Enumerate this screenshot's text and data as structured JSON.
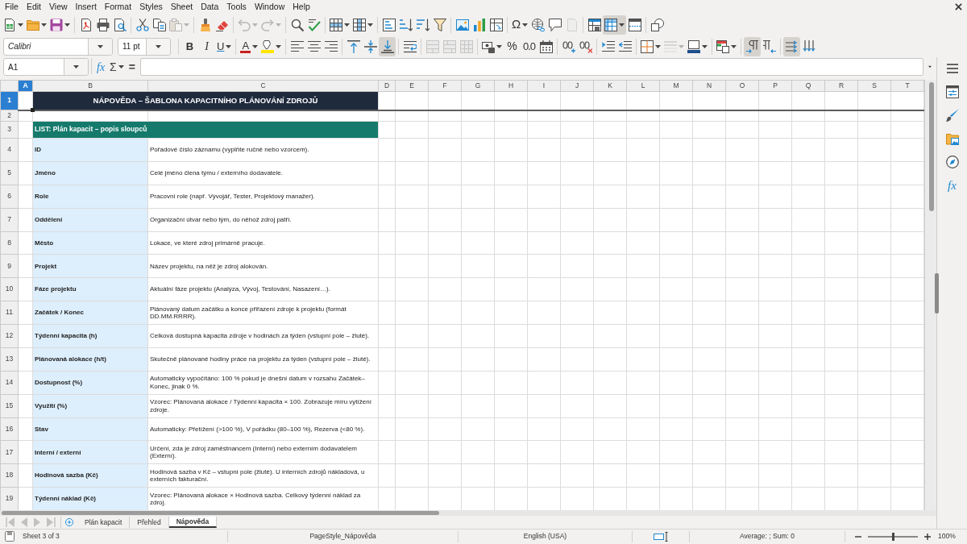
{
  "menu": [
    "File",
    "Edit",
    "View",
    "Insert",
    "Format",
    "Styles",
    "Sheet",
    "Data",
    "Tools",
    "Window",
    "Help"
  ],
  "standard_toolbar": [
    {
      "pressed": false,
      "disabled": false
    },
    {
      "pressed": false,
      "disabled": false
    },
    {
      "pressed": false,
      "disabled": false
    },
    {
      "pressed": false,
      "disabled": false
    },
    {
      "pressed": false,
      "disabled": false
    },
    {
      "pressed": false,
      "disabled": false
    },
    {
      "pressed": false,
      "disabled": false
    },
    {
      "pressed": false,
      "disabled": false
    },
    {
      "pressed": false,
      "disabled": true
    },
    {
      "pressed": false,
      "disabled": false
    },
    {
      "pressed": false,
      "disabled": false
    },
    {
      "pressed": false,
      "disabled": true
    },
    {
      "pressed": false,
      "disabled": true
    },
    {
      "pressed": false,
      "disabled": false
    },
    {
      "pressed": false,
      "disabled": false
    },
    {
      "pressed": false,
      "disabled": false
    },
    {
      "pressed": false,
      "disabled": false
    },
    {
      "pressed": false,
      "disabled": false
    },
    {
      "pressed": false,
      "disabled": false
    },
    {
      "pressed": false,
      "disabled": false
    },
    {
      "pressed": false,
      "disabled": false
    },
    {
      "pressed": false,
      "disabled": false
    },
    {
      "pressed": false,
      "disabled": false
    },
    {
      "pressed": false,
      "disabled": false
    },
    {
      "pressed": false,
      "disabled": false,
      "label": "Ω"
    },
    {
      "pressed": false,
      "disabled": false
    },
    {
      "pressed": false,
      "disabled": false
    },
    {
      "pressed": false,
      "disabled": true
    },
    {
      "pressed": false,
      "disabled": false
    },
    {
      "pressed": true,
      "disabled": false
    },
    {
      "pressed": false,
      "disabled": false
    },
    {
      "pressed": false,
      "disabled": false
    }
  ],
  "formatting_toolbar": {
    "font_name": "Calibri",
    "font_size": "11 pt",
    "buttons": [
      {
        "pressed": false,
        "disabled": false,
        "label": "B"
      },
      {
        "pressed": false,
        "disabled": false,
        "label": "I"
      },
      {
        "pressed": false,
        "disabled": false,
        "label": "U"
      },
      {
        "pressed": false,
        "disabled": false,
        "label": "A"
      },
      {
        "pressed": false,
        "disabled": false
      },
      {
        "pressed": false,
        "disabled": false
      },
      {
        "pressed": false,
        "disabled": false
      },
      {
        "pressed": false,
        "disabled": false
      },
      {
        "pressed": false,
        "disabled": false
      },
      {
        "pressed": false,
        "disabled": false
      },
      {
        "pressed": true,
        "disabled": false
      },
      {
        "pressed": false,
        "disabled": false
      },
      {
        "pressed": false,
        "disabled": true
      },
      {
        "pressed": false,
        "disabled": true
      },
      {
        "pressed": false,
        "disabled": true
      },
      {
        "pressed": false,
        "disabled": false
      },
      {
        "pressed": false,
        "disabled": false,
        "label": "%"
      },
      {
        "pressed": false,
        "disabled": false,
        "label": "0.0"
      },
      {
        "pressed": false,
        "disabled": false
      },
      {
        "pressed": false,
        "disabled": false
      },
      {
        "pressed": false,
        "disabled": false
      },
      {
        "pressed": false,
        "disabled": false
      },
      {
        "pressed": false,
        "disabled": false
      },
      {
        "pressed": false,
        "disabled": false
      },
      {
        "pressed": false,
        "disabled": true
      },
      {
        "pressed": false,
        "disabled": false
      },
      {
        "pressed": false,
        "disabled": false
      },
      {
        "pressed": true,
        "disabled": false
      },
      {
        "pressed": false,
        "disabled": false
      },
      {
        "pressed": true,
        "disabled": false
      },
      {
        "pressed": false,
        "disabled": false
      }
    ]
  },
  "formula_bar": {
    "cell_reference": "A1",
    "function_wizard": "fx",
    "sum": "Σ",
    "equals": "="
  },
  "sidebar": {
    "functions_label": "fx"
  },
  "sheet": {
    "columns": [
      {
        "label": "A",
        "selected": true
      },
      {
        "label": "B",
        "selected": false
      },
      {
        "label": "C",
        "selected": false
      },
      {
        "label": "D",
        "selected": false
      },
      {
        "label": "E",
        "selected": false
      },
      {
        "label": "F",
        "selected": false
      },
      {
        "label": "G",
        "selected": false
      },
      {
        "label": "H",
        "selected": false
      },
      {
        "label": "I",
        "selected": false
      },
      {
        "label": "J",
        "selected": false
      },
      {
        "label": "K",
        "selected": false
      },
      {
        "label": "L",
        "selected": false
      },
      {
        "label": "M",
        "selected": false
      },
      {
        "label": "N",
        "selected": false
      },
      {
        "label": "O",
        "selected": false
      },
      {
        "label": "P",
        "selected": false
      },
      {
        "label": "Q",
        "selected": false
      },
      {
        "label": "R",
        "selected": false
      },
      {
        "label": "S",
        "selected": false
      },
      {
        "label": "T",
        "selected": false
      }
    ],
    "rows": [
      {
        "number": "1",
        "selected": true,
        "kind": "title",
        "text": "NÁPOVĚDA – ŠABLONA KAPACITNÍHO PLÁNOVÁNÍ ZDROJŮ"
      },
      {
        "number": "2",
        "selected": false,
        "kind": "blank"
      },
      {
        "number": "3",
        "selected": false,
        "kind": "section",
        "text": "LIST: Plán kapacit – popis sloupců"
      },
      {
        "number": "4",
        "selected": false,
        "kind": "field",
        "name": "ID",
        "description": "Pořadové číslo záznamu (vyplňte ručně nebo vzorcem)."
      },
      {
        "number": "5",
        "selected": false,
        "kind": "field",
        "name": "Jméno",
        "description": "Celé jméno člena týmu / externího dodavatele."
      },
      {
        "number": "6",
        "selected": false,
        "kind": "field",
        "name": "Role",
        "description": "Pracovní role (např. Vývojář, Tester, Projektový manažer)."
      },
      {
        "number": "7",
        "selected": false,
        "kind": "field",
        "name": "Oddělení",
        "description": "Organizační útvar nebo tým, do něhož zdroj patří."
      },
      {
        "number": "8",
        "selected": false,
        "kind": "field",
        "name": "Město",
        "description": "Lokace, ve které zdroj primárně pracuje."
      },
      {
        "number": "9",
        "selected": false,
        "kind": "field",
        "name": "Projekt",
        "description": "Název projektu, na něž je zdroj alokován."
      },
      {
        "number": "10",
        "selected": false,
        "kind": "field",
        "name": "Fáze projektu",
        "description": "Aktuální fáze projektu (Analýza, Vývoj, Testování, Nasazení…)."
      },
      {
        "number": "11",
        "selected": false,
        "kind": "field",
        "name": "Začátek / Konec",
        "description": "Plánovaný datum začátku a konce přiřazení zdroje k projektu (formát DD.MM.RRRR)."
      },
      {
        "number": "12",
        "selected": false,
        "kind": "field",
        "name": "Týdenní kapacita (h)",
        "description": "Celková dostupná kapacita zdroje v hodinách za týden (vstupní pole – žluté)."
      },
      {
        "number": "13",
        "selected": false,
        "kind": "field",
        "name": "Plánovaná alokace (h/t)",
        "description": "Skutečně plánované hodiny práce na projektu za týden (vstupní pole – žluté)."
      },
      {
        "number": "14",
        "selected": false,
        "kind": "field",
        "name": "Dostupnost (%)",
        "description": "Automaticky vypočítáno: 100 % pokud je dnešní datum v rozsahu Začátek–Konec, jinak 0 %."
      },
      {
        "number": "15",
        "selected": false,
        "kind": "field",
        "name": "Využití (%)",
        "description": "Vzorec: Plánovaná alokace / Týdenní kapacita × 100. Zobrazuje míru vytížení zdroje."
      },
      {
        "number": "16",
        "selected": false,
        "kind": "field",
        "name": "Stav",
        "description": "Automaticky: Přetížení (>100 %), V pořádku (80–100 %), Rezerva (<80 %)."
      },
      {
        "number": "17",
        "selected": false,
        "kind": "field",
        "name": "Interní / externí",
        "description": "Určení, zda je zdroj zaměstnancem (Interní) nebo externím dodavatelem (Externí)."
      },
      {
        "number": "18",
        "selected": false,
        "kind": "field",
        "name": "Hodinová sazba (Kč)",
        "description": "Hodinová sazba v Kč – vstupní pole (žluté). U interních zdrojů nákladová, u externích fakturační."
      },
      {
        "number": "19",
        "selected": false,
        "kind": "field",
        "name": "Týdenní náklad (Kč)",
        "description": "Vzorec: Plánovaná alokace × Hodinová sazba. Celkový týdenní náklad za zdroj."
      }
    ]
  },
  "sheet_tabs": {
    "navigation_disabled": true,
    "tabs": [
      {
        "label": "Plán kapacit",
        "selected": false
      },
      {
        "label": "Přehled",
        "selected": false
      },
      {
        "label": "Nápověda",
        "selected": true
      }
    ]
  },
  "status_bar": {
    "sheet": "Sheet 3 of 3",
    "page_style": "PageStyle_Nápověda",
    "language": "English (USA)",
    "summary": "Average: ; Sum: 0",
    "zoom": {
      "level": 0.5,
      "reading": "100%"
    }
  }
}
